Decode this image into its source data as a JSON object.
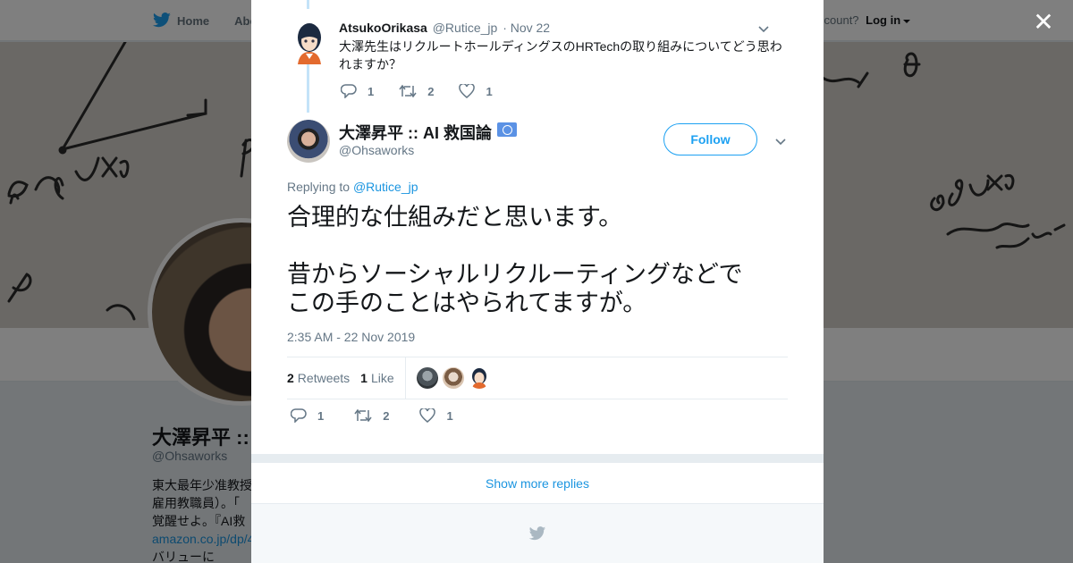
{
  "background": {
    "nav": {
      "home": "Home",
      "about": "Abo"
    },
    "login": {
      "prompt": "ccount?",
      "login": "Log in"
    },
    "profile": {
      "name": "大澤昇平 ::",
      "handle": "@Ohsaworks",
      "bio_lines": [
        "東大最年少准教授",
        "雇用教職員）。「",
        "覚醒せよ。『AI救",
        "amazon.co.jp/dp/4",
        "バリューに"
      ]
    }
  },
  "modal": {
    "parent_reply": {
      "fullname": "AtsukoOrikasa",
      "handle": "@Rutice_jp",
      "date": "· Nov 22",
      "text": "大澤先生はリクルートホールディングスのHRTechの取り組みについてどう思われますか？",
      "actions": {
        "replies": "1",
        "retweets": "2",
        "likes": "1"
      }
    },
    "tweet": {
      "fullname": "大澤昇平 :: AI 救国論",
      "handle": "@Ohsaworks",
      "follow_label": "Follow",
      "replying_prefix": "Replying to",
      "replying_to": "@Rutice_jp",
      "text_p1": "合理的な仕組みだと思います。",
      "text_p2_l1": "昔からソーシャルリクルーティングなどで",
      "text_p2_l2": "この手のことはやられてますが。",
      "timestamp": "2:35 AM - 22 Nov 2019",
      "stats": {
        "retweets_count": "2",
        "retweets_label": "Retweets",
        "likes_count": "1",
        "likes_label": "Like"
      },
      "actions": {
        "replies": "1",
        "retweets": "2",
        "likes": "1"
      }
    },
    "show_more_label": "Show more replies"
  },
  "colors": {
    "accent": "#1da1f2",
    "link": "#1b95e0",
    "muted": "#657786",
    "overlay": "rgba(0,0,0,0.5)"
  },
  "icons": [
    "twitter-bird-icon",
    "close-icon",
    "chevron-down-icon",
    "reply-icon",
    "retweet-icon",
    "like-icon",
    "un-flag-icon"
  ]
}
